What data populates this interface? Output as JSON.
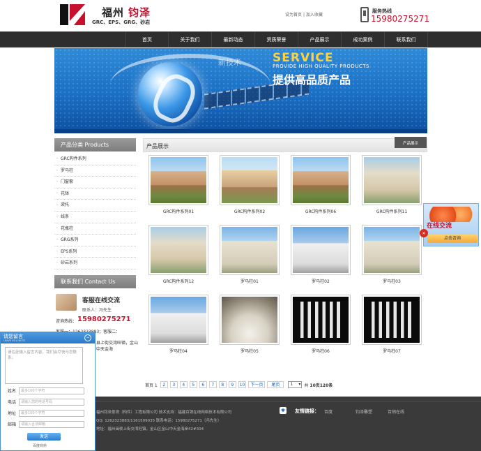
{
  "header": {
    "logo_cn_a": "福州",
    "logo_cn_b": "钧泽",
    "logo_en": "GRC、EPS、GRG、砂岩",
    "top_links": [
      "设为首页",
      "加入收藏"
    ],
    "hotline_label": "服务热线",
    "hotline_number": "15980275271"
  },
  "nav": [
    "首页",
    "关于我们",
    "最新动态",
    "资质荣誉",
    "产品展示",
    "成功案例",
    "联系我们"
  ],
  "banner": {
    "overlay": "新技术",
    "title": "SERVICE",
    "subtitle": "PROVIDE HIGH QUALITY PRODUCTS",
    "cn": "提供高品质产品"
  },
  "sidebar": {
    "categories_title": "产品分类 Products",
    "categories": [
      "GRC构件系列",
      "罗马柱",
      "门窗套",
      "花钵",
      "梁托",
      "线条",
      "花瓶柱",
      "GRG系列",
      "EPS系列",
      "砂岩系列"
    ],
    "contact_title": "联系我们 Contact Us",
    "service_title": "客服在线交流",
    "service_contact": "联系人：冯先生",
    "hotline_label": "咨询热线：",
    "hotline": "15980275271",
    "phones": "客服一：1262323883；客服二：1161509035",
    "address": "县上街交湾旺镇，金山中天金海"
  },
  "main": {
    "title": "产品展示",
    "crumb_home": "首页",
    "crumb_current": "产品展示",
    "products": [
      {
        "name": "GRC构件系列01",
        "pic": "villa"
      },
      {
        "name": "GRC构件系列02",
        "pic": "villa2"
      },
      {
        "name": "GRC构件系列06",
        "pic": "villa"
      },
      {
        "name": "GRC构件系列11",
        "pic": "palace"
      },
      {
        "name": "GRC构件系列12",
        "pic": "palace"
      },
      {
        "name": "罗马柱01",
        "pic": "colonnade"
      },
      {
        "name": "罗马柱02",
        "pic": "white"
      },
      {
        "name": "罗马柱03",
        "pic": "colonnade"
      },
      {
        "name": "罗马柱04",
        "pic": "white"
      },
      {
        "name": "罗马柱05",
        "pic": "dome"
      },
      {
        "name": "罗马柱06",
        "pic": "black"
      },
      {
        "name": "罗马柱07",
        "pic": "black"
      }
    ]
  },
  "pager": {
    "label": "首页 1",
    "pages": [
      "2",
      "3",
      "4",
      "5",
      "6",
      "7",
      "8",
      "9",
      "10"
    ],
    "next": "下一页",
    "last": "尾页",
    "select_value": "1",
    "total_prefix": "共",
    "total": "10页120条"
  },
  "footer": {
    "line1": "福州钧泽景观（构件）工程有限公司 技术支持：福建百销在线网络技术有限公司",
    "line2": "QQ: 1262323883/1161509035 联系电话：15980275271（冯先生）",
    "line3": "地址：福州闽侯上街交湾旺镇，金山区金山中天金海岸42#304",
    "friend_label": "友情链接：",
    "friend_links": [
      "百度",
      "钧泽雕塑",
      "百销在线"
    ]
  },
  "chat_float": {
    "title": "在线交流",
    "button": "点击咨询",
    "close": "×"
  },
  "message_box": {
    "title": "请您留言",
    "subtitle": "LEAVE US A NOTE",
    "close": "−",
    "placeholder": "请在此输入留言内容，我们会尽快与您联系。",
    "fields": [
      {
        "label": "姓名",
        "placeholder": "最多100个字符"
      },
      {
        "label": "电话",
        "placeholder": "请输入您的电话号码"
      },
      {
        "label": "地址",
        "placeholder": "最多100个字符"
      },
      {
        "label": "邮箱",
        "placeholder": "请输入合法邮箱"
      }
    ],
    "send": "发送",
    "powered": "百度商桥"
  }
}
